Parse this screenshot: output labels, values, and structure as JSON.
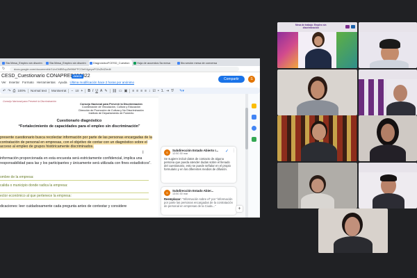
{
  "browser": {
    "tabs": [
      {
        "label": "Sta Mesa_Empleo sin discrim",
        "active": false
      },
      {
        "label": "Sta Mesa_Empleo sin discrim",
        "active": false
      },
      {
        "label": "DiagnósticoFCESD_Cuestion",
        "active": true
      },
      {
        "label": "Hoja de acuerdos 5a mesa",
        "active": false
      },
      {
        "label": "5ta sesión mesa de conversa",
        "active": false
      }
    ],
    "url": "docs.google.com/document/d/1UoOl4BEopZbfWkFFCOeK4geyoF02cZbIZ/edit"
  },
  "doc": {
    "title": "CESD_Cuestionario CONAPRED150322",
    "badge": ".DOCX",
    "menu": [
      "Ver",
      "Insertar",
      "Formato",
      "Herramientas",
      "Ayuda"
    ],
    "last_edit": "Última modificación hace 2 horas por anónimo",
    "share_label": "Compartir",
    "user_initial": "S",
    "toolbar": {
      "style": "Normal text",
      "font": "Montserrat",
      "size": "10",
      "zoom": "100%"
    },
    "logo_text": "Consejo Nacional para Prevenir la Discriminación",
    "institution_lines": [
      "Consejo Nacional para Prevenir la Discriminación",
      "Coordinación de Vinculación, Cultura y Educación",
      "Dirección de Promoción de Cultura y No Discriminación",
      "Instituto de Departamento de Fomento"
    ],
    "heading": "Cuestionario diagnóstico",
    "subheading": "“Fortalecimiento de capacidades para el empleo sin discriminación”",
    "paragraph1": "presente cuestionario busca recolectar información por parte de las personas encargadas de la contratación de personal en empresas, con el objetivo de contar con un diagnóstico sobre el acceso al empleo de grupos históricamente discriminados.",
    "paragraph2": "información proporcionada en esta encuesta será estrictamente confidencial, implica una responsabilidad para las y los participantes y únicamente será utilizada con fines estadísticos”.",
    "fields": [
      "ombre de la empresa:",
      "calida     o     municipio     donde     radica     la empresa:",
      "ector económico al que pertenece la empresa:"
    ],
    "cutoff_line": "dicaciones: leer cuidadosamente cada pregunta antes de contestar y considere"
  },
  "comments": [
    {
      "author": "Subdirección Estado Abierto I...",
      "time": "12:50 30 mar",
      "initial": "S",
      "body": "Se sugiere incluir datos de contacto de alguna persona que pueda atender dudas sobre el llenado del cuestionario, esto se puede señalar en el propio formulario y en los diferentes medios de difusión."
    },
    {
      "author": "Subdirección Estado Abier...",
      "time": "13:50 30 mar",
      "initial": "S",
      "replace_label": "Reemplazar:",
      "body": "\"Información sobre el\" por \"información por parte las personas encargadas de la contratación de personal en empresas de la Ciuda...\""
    }
  ],
  "video": {
    "banner_text": "Mesa de trabajo: Empleo sin discriminación",
    "participants": 11
  },
  "colors": {
    "share_button": "#1a73e8",
    "highlight": "#fbe4a9",
    "background": "#202124",
    "avatar": "#e37400"
  }
}
